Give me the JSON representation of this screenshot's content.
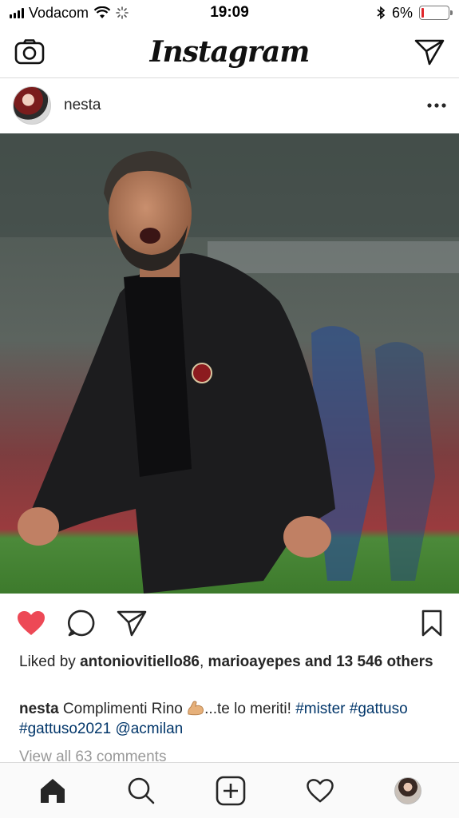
{
  "status_bar": {
    "carrier": "Vodacom",
    "time": "19:09",
    "battery_percent": "6%",
    "battery_level": 0.06,
    "icons": [
      "signal-icon",
      "wifi-icon",
      "activity-spinner-icon",
      "bluetooth-icon",
      "battery-icon"
    ]
  },
  "header": {
    "logo": "Instagram",
    "icons": [
      "camera-icon",
      "direct-message-icon"
    ]
  },
  "post": {
    "username": "nesta",
    "more_icon": "more-options-icon",
    "likes": {
      "prefix": "Liked by",
      "user1": "antoniovitiello86",
      "separator": ",",
      "user2": "marioayepes",
      "suffix": "and 13 546 others"
    },
    "caption": {
      "username": "nesta",
      "text_before": "Complimenti Rino",
      "text_after": "...te lo meriti!",
      "tag1": "#mister",
      "tag2": "#gattuso",
      "tag3": "#gattuso2021",
      "mention": "@acmilan"
    },
    "view_all": "View all 63 comments",
    "liked": true
  },
  "colors": {
    "like_red": "#ed4956",
    "link_blue": "#003569",
    "battery_red": "#e0262b"
  },
  "bottom_nav": {
    "items": [
      "home-icon",
      "search-icon",
      "new-post-icon",
      "activity-heart-icon",
      "profile-avatar"
    ]
  }
}
